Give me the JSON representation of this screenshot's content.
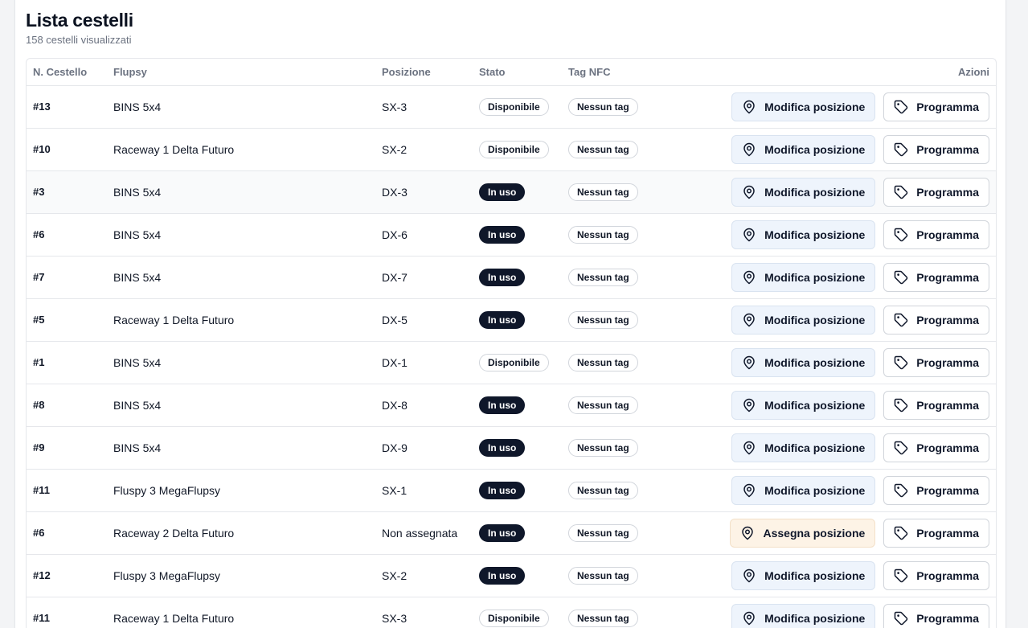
{
  "header": {
    "title": "Lista cestelli",
    "subtitle": "158 cestelli visualizzati"
  },
  "columns": {
    "num": "N. Cestello",
    "flupsy": "Flupsy",
    "position": "Posizione",
    "status": "Stato",
    "nfc": "Tag NFC",
    "actions": "Azioni"
  },
  "labels": {
    "edit_position": "Modifica posizione",
    "assign_position": "Assegna posizione",
    "program": "Programma"
  },
  "icons": {
    "position": "map-pin-icon",
    "program": "tag-icon"
  },
  "colors": {
    "status_used": "#0f172a",
    "edit_button_bg": "#eef4fc",
    "assign_button_bg": "#fdf3e6"
  },
  "rows": [
    {
      "num": "#13",
      "flupsy": "BINS 5x4",
      "position": "SX-3",
      "status": "Disponibile",
      "status_type": "free",
      "nfc": "Nessun tag",
      "action": "edit"
    },
    {
      "num": "#10",
      "flupsy": "Raceway 1 Delta Futuro",
      "position": "SX-2",
      "status": "Disponibile",
      "status_type": "free",
      "nfc": "Nessun tag",
      "action": "edit"
    },
    {
      "num": "#3",
      "flupsy": "BINS 5x4",
      "position": "DX-3",
      "status": "In uso",
      "status_type": "used",
      "nfc": "Nessun tag",
      "action": "edit"
    },
    {
      "num": "#6",
      "flupsy": "BINS 5x4",
      "position": "DX-6",
      "status": "In uso",
      "status_type": "used",
      "nfc": "Nessun tag",
      "action": "edit"
    },
    {
      "num": "#7",
      "flupsy": "BINS 5x4",
      "position": "DX-7",
      "status": "In uso",
      "status_type": "used",
      "nfc": "Nessun tag",
      "action": "edit"
    },
    {
      "num": "#5",
      "flupsy": "Raceway 1 Delta Futuro",
      "position": "DX-5",
      "status": "In uso",
      "status_type": "used",
      "nfc": "Nessun tag",
      "action": "edit"
    },
    {
      "num": "#1",
      "flupsy": "BINS 5x4",
      "position": "DX-1",
      "status": "Disponibile",
      "status_type": "free",
      "nfc": "Nessun tag",
      "action": "edit"
    },
    {
      "num": "#8",
      "flupsy": "BINS 5x4",
      "position": "DX-8",
      "status": "In uso",
      "status_type": "used",
      "nfc": "Nessun tag",
      "action": "edit"
    },
    {
      "num": "#9",
      "flupsy": "BINS 5x4",
      "position": "DX-9",
      "status": "In uso",
      "status_type": "used",
      "nfc": "Nessun tag",
      "action": "edit"
    },
    {
      "num": "#11",
      "flupsy": "Fluspy 3 MegaFlupsy",
      "position": "SX-1",
      "status": "In uso",
      "status_type": "used",
      "nfc": "Nessun tag",
      "action": "edit"
    },
    {
      "num": "#6",
      "flupsy": "Raceway 2 Delta Futuro",
      "position": "Non assegnata",
      "status": "In uso",
      "status_type": "used",
      "nfc": "Nessun tag",
      "action": "assign"
    },
    {
      "num": "#12",
      "flupsy": "Fluspy 3 MegaFlupsy",
      "position": "SX-2",
      "status": "In uso",
      "status_type": "used",
      "nfc": "Nessun tag",
      "action": "edit"
    },
    {
      "num": "#11",
      "flupsy": "Raceway 1 Delta Futuro",
      "position": "SX-3",
      "status": "Disponibile",
      "status_type": "free",
      "nfc": "Nessun tag",
      "action": "edit"
    }
  ]
}
